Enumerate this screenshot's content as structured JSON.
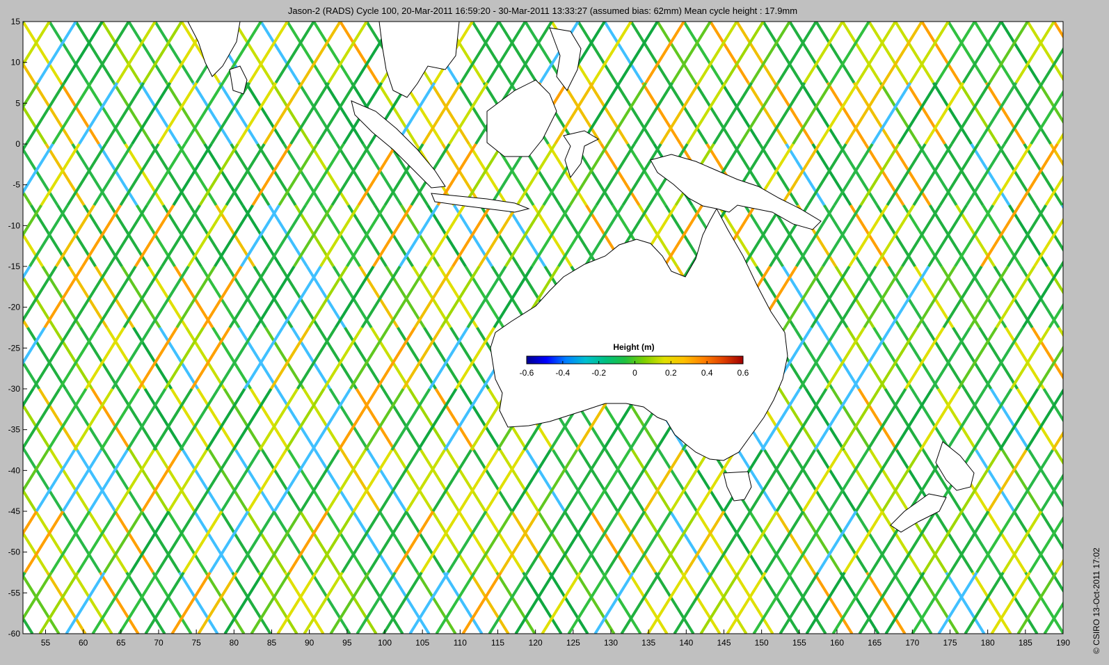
{
  "title": "Jason-2 (RADS) Cycle 100, 20-Mar-2011 16:59:20 - 30-Mar-2011 13:33:27 (assumed bias: 62mm)  Mean cycle height : 17.9mm",
  "credit": "© CSIRO 13-Oct-2011 17:02",
  "map": {
    "lon_range": [
      52,
      190
    ],
    "lat_range": [
      -60,
      15
    ],
    "x_ticks": [
      "55",
      "60",
      "65",
      "70",
      "75",
      "80",
      "85",
      "90",
      "95",
      "100",
      "105",
      "110",
      "115",
      "120",
      "125",
      "130",
      "135",
      "140",
      "145",
      "150",
      "155",
      "160",
      "165",
      "170",
      "175",
      "180",
      "185",
      "190"
    ],
    "y_ticks": [
      "15",
      "10",
      "5",
      "0",
      "-5",
      "-10",
      "-15",
      "-20",
      "-25",
      "-30",
      "-35",
      "-40",
      "-45",
      "-50",
      "-55",
      "-60"
    ],
    "land_color": "#ffffff",
    "plot_background": "#ffffff"
  },
  "colorbar": {
    "label": "Height (m)",
    "ticks": [
      "-0.6",
      "-0.4",
      "-0.2",
      "0",
      "0.2",
      "0.4",
      "0.6"
    ],
    "range": [
      -0.6,
      0.6
    ],
    "colors": [
      "#00008f",
      "#0000ff",
      "#0080ff",
      "#00c0d0",
      "#00c080",
      "#20c040",
      "#80d000",
      "#e0e000",
      "#ffc000",
      "#ff8000",
      "#e04000",
      "#a00000"
    ]
  }
}
